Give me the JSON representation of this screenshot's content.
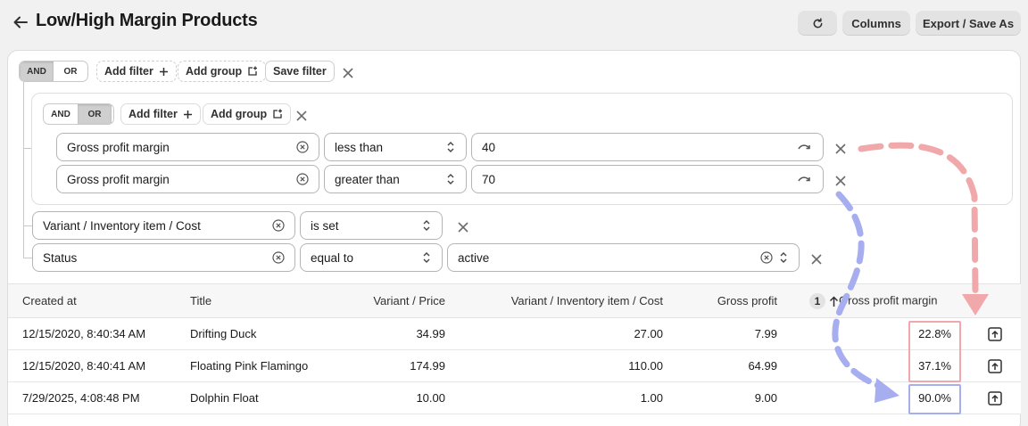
{
  "header": {
    "title": "Low/High Margin Products",
    "columns_label": "Columns",
    "export_label": "Export / Save As"
  },
  "filter": {
    "root_and": "AND",
    "root_or": "OR",
    "add_filter": "Add filter",
    "add_group": "Add group",
    "save_filter": "Save filter",
    "group": {
      "and": "AND",
      "or": "OR",
      "add_filter": "Add filter",
      "add_group": "Add group",
      "rows": [
        {
          "field": "Gross profit margin",
          "operator": "less than",
          "value": "40"
        },
        {
          "field": "Gross profit margin",
          "operator": "greater than",
          "value": "70"
        }
      ]
    },
    "rows": [
      {
        "field": "Variant / Inventory item / Cost",
        "operator": "is set"
      },
      {
        "field": "Status",
        "operator": "equal to",
        "value": "active"
      }
    ]
  },
  "table": {
    "headers": {
      "created_at": "Created at",
      "title": "Title",
      "price": "Variant / Price",
      "cost": "Variant / Inventory item / Cost",
      "gross_profit": "Gross profit",
      "sort_index": "1",
      "margin": "Gross profit margin"
    },
    "rows": [
      {
        "created_at": "12/15/2020, 8:40:34 AM",
        "title": "Drifting Duck",
        "price": "34.99",
        "cost": "27.00",
        "gross_profit": "7.99",
        "margin": "22.8%"
      },
      {
        "created_at": "12/15/2020, 8:40:41 AM",
        "title": "Floating Pink Flamingo",
        "price": "174.99",
        "cost": "110.00",
        "gross_profit": "64.99",
        "margin": "37.1%"
      },
      {
        "created_at": "7/29/2025, 4:08:48 PM",
        "title": "Dolphin Float",
        "price": "10.00",
        "cost": "1.00",
        "gross_profit": "9.00",
        "margin": "90.0%"
      }
    ]
  },
  "colors": {
    "annotation_red": "#f0a8aa",
    "annotation_blue": "#a7aef0"
  }
}
